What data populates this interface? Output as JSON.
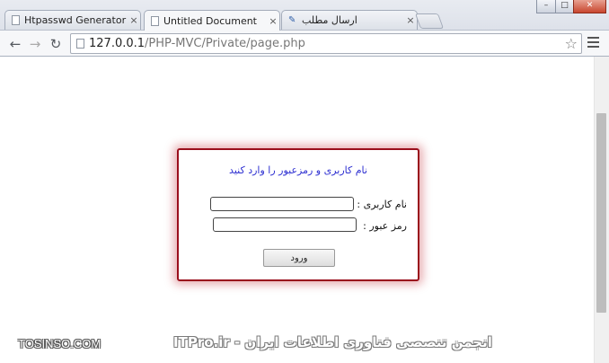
{
  "tabs": [
    {
      "label": "Htpasswd Generator - Cre",
      "icon": "page-icon",
      "active": false
    },
    {
      "label": "Untitled Document",
      "icon": "page-icon",
      "active": true
    },
    {
      "label": "ارسال مطلب",
      "icon": "quill-icon",
      "active": false
    }
  ],
  "tab_close_glyph": "×",
  "window_controls": {
    "minimize": "–",
    "maximize": "□",
    "close": "✕"
  },
  "toolbar": {
    "back_glyph": "←",
    "forward_glyph": "→",
    "reload_glyph": "↻",
    "url_host": "127.0.0.1",
    "url_path": "/PHP-MVC/Private/page.php",
    "star_glyph": "☆"
  },
  "login": {
    "title": "نام کاربری و رمزعبور را وارد کنید",
    "username_label": "نام کاربری :",
    "username_value": "",
    "password_label": "رمز عبور :",
    "password_value": "",
    "submit_label": "ورود"
  },
  "watermarks": {
    "left": "TOSINSO.COM",
    "right": "ITPro.ir - انجمن تنصصی فناوری اطلاعات ایران"
  },
  "colors": {
    "login_border": "#9a0f1c",
    "login_title": "#2d2fd1",
    "close_button": "#c8462e"
  }
}
